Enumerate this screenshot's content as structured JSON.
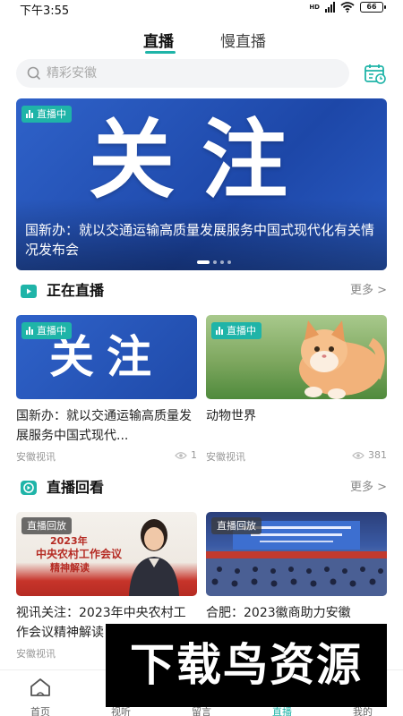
{
  "status_bar": {
    "time": "下午3:55",
    "battery": "66"
  },
  "top_tabs": [
    {
      "label": "直播",
      "active": true
    },
    {
      "label": "慢直播",
      "active": false
    }
  ],
  "search": {
    "placeholder": "精彩安徽"
  },
  "banner": {
    "badge": "直播中",
    "image_text": "关注",
    "title": "国新办：就以交通运输高质量发展服务中国式现代化有关情况发布会",
    "dots": 4,
    "active_dot": 0
  },
  "live_section": {
    "title": "正在直播",
    "more": "更多 >",
    "cards": [
      {
        "badge": "直播中",
        "image_text": "关注",
        "title": "国新办：就以交通运输高质量发展服务中国式现代...",
        "source": "安徽视讯",
        "views": "1"
      },
      {
        "badge": "直播中",
        "title": "动物世界",
        "source": "安徽视讯",
        "views": "381"
      }
    ]
  },
  "replay_section": {
    "title": "直播回看",
    "more": "更多 >",
    "cards": [
      {
        "badge": "直播回放",
        "image_text": [
          "2023年",
          "中央农村工作会议",
          "精神解读"
        ],
        "title": "视讯关注：2023年中央农村工作会议精神解读",
        "source": "安徽视讯"
      },
      {
        "badge": "直播回放",
        "title": "合肥：2023徽商助力安徽"
      }
    ]
  },
  "tabbar": [
    {
      "label": "首页",
      "icon": "home-icon",
      "active": false
    },
    {
      "label": "视听",
      "icon": "video-icon",
      "active": false
    },
    {
      "label": "留言",
      "icon": "message-icon",
      "active": false
    },
    {
      "label": "直播",
      "icon": "live-icon",
      "active": true
    },
    {
      "label": "我的",
      "icon": "user-icon",
      "active": false
    }
  ],
  "watermark": "下载鸟资源",
  "colors": {
    "accent": "#1fb4a8",
    "banner_blue": "#2a58c0"
  }
}
